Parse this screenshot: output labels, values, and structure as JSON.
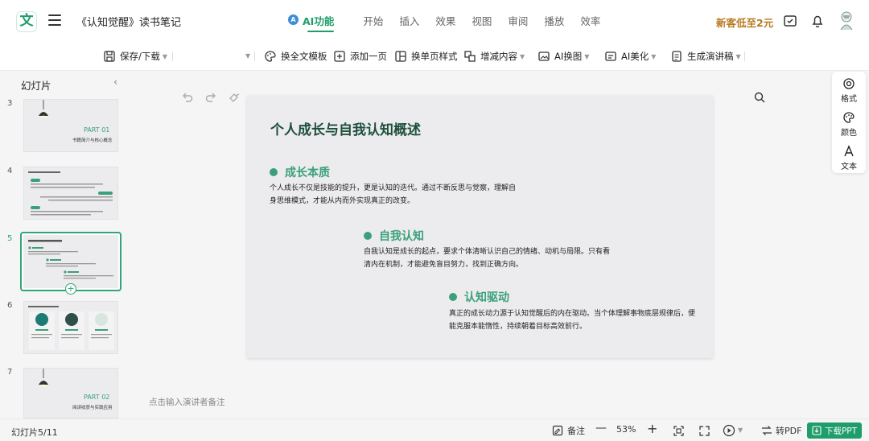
{
  "header": {
    "logo_text": "文",
    "doc_title": "《认知觉醒》读书笔记",
    "tabs": [
      {
        "label": "AI功能",
        "active": true
      },
      {
        "label": "开始"
      },
      {
        "label": "插入"
      },
      {
        "label": "效果"
      },
      {
        "label": "视图"
      },
      {
        "label": "审阅"
      },
      {
        "label": "播放"
      },
      {
        "label": "效率"
      }
    ],
    "promo": "新客低至2元",
    "accent_color": "#1f9e6b"
  },
  "toolbar": {
    "save": "保存/下载",
    "replace_template": "换全文模板",
    "add_page": "添加一页",
    "single_style": "换单页样式",
    "adjust_content": "增减内容",
    "ai_image": "AI换图",
    "ai_beautify": "AI美化",
    "gen_script": "生成演讲稿"
  },
  "sidebar": {
    "title": "幻灯片",
    "slides": [
      {
        "num": "3",
        "part": "PART  01",
        "subtitle": "书籍简介与核心概念"
      },
      {
        "num": "4"
      },
      {
        "num": "5"
      },
      {
        "num": "6"
      },
      {
        "num": "7",
        "part": "PART  02",
        "subtitle": "阅读收获与实践应用"
      }
    ]
  },
  "slide": {
    "title": "个人成长与自我认知概述",
    "sections": [
      {
        "heading": "成长本质",
        "lines": [
          "个人成长不仅是技能的提升，更是认知的迭代。通过不断反思与觉察，理解自",
          "身思维模式，才能从内而外实现真正的改变。"
        ]
      },
      {
        "heading": "自我认知",
        "lines": [
          "自我认知是成长的起点，要求个体清晰认识自己的情绪、动机与局限。只有看",
          "清内在机制，才能避免盲目努力，找到正确方向。"
        ]
      },
      {
        "heading": "认知驱动",
        "lines": [
          "真正的成长动力源于认知觉醒后的内在驱动。当个体理解事物底层规律后，便",
          "能克服本能惰性，持续朝着目标高效前行。"
        ]
      }
    ],
    "accent_color": "#3aa07a"
  },
  "notes_placeholder": "点击输入演讲者备注",
  "right_panel": {
    "format": "格式",
    "color": "颜色",
    "text": "文本"
  },
  "statusbar": {
    "pages": "幻灯片5/11",
    "notes": "备注",
    "zoom": "53%",
    "to_pdf": "转PDF",
    "download_ppt": "下载PPT"
  }
}
